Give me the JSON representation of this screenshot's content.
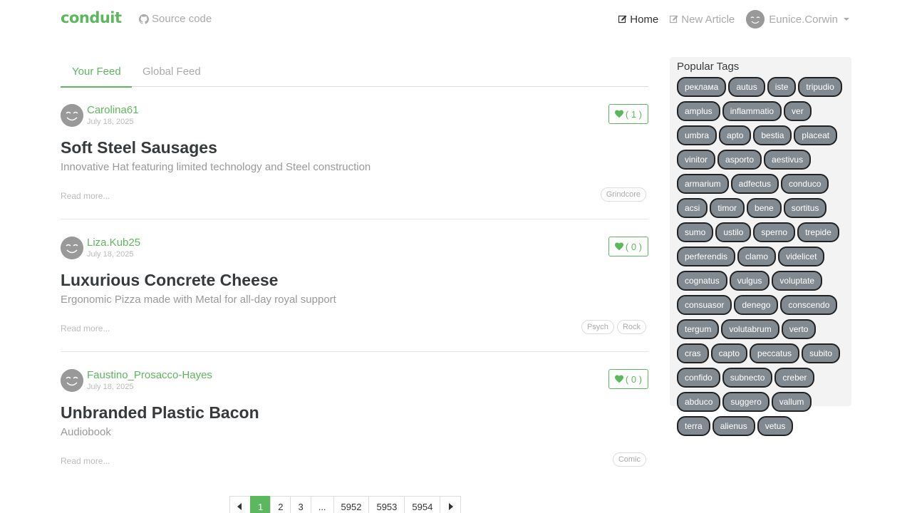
{
  "navbar": {
    "brand": "conduit",
    "source_label": "Source code",
    "home_label": "Home",
    "new_article_label": "New Article",
    "username": "Eunice.Corwin"
  },
  "feed": {
    "tabs": [
      {
        "label": "Your Feed",
        "active": true
      },
      {
        "label": "Global Feed",
        "active": false
      }
    ]
  },
  "articles": [
    {
      "author": "Carolina61",
      "date": "July 18, 2025",
      "likes": "( 1 )",
      "title": "Soft Steel Sausages",
      "description": "Innovative Hat featuring limited technology and Steel construction",
      "read_more": "Read more...",
      "tags": [
        "Grindcore"
      ]
    },
    {
      "author": "Liza.Kub25",
      "date": "July 18, 2025",
      "likes": "( 0 )",
      "title": "Luxurious Concrete Cheese",
      "description": "Ergonomic Pizza made with Metal for all-day royal support",
      "read_more": "Read more...",
      "tags": [
        "Psych",
        "Rock"
      ]
    },
    {
      "author": "Faustino_Prosacco-Hayes",
      "date": "July 18, 2025",
      "likes": "( 0 )",
      "title": "Unbranded Plastic Bacon",
      "description": "Audiobook",
      "read_more": "Read more...",
      "tags": [
        "Comic"
      ]
    }
  ],
  "sidebar": {
    "title": "Popular Tags",
    "tags": [
      "реклама",
      "autus",
      "iste",
      "tripudio",
      "amplus",
      "inflammatio",
      "ver",
      "umbra",
      "apto",
      "bestia",
      "placeat",
      "vinitor",
      "asporto",
      "aestivus",
      "armarium",
      "adfectus",
      "conduco",
      "acsi",
      "timor",
      "bene",
      "sortitus",
      "sumo",
      "ustilo",
      "sperno",
      "trepide",
      "perferendis",
      "clamo",
      "videlicet",
      "cognatus",
      "vulgus",
      "voluptate",
      "consuasor",
      "denego",
      "conscendo",
      "tergum",
      "volutabrum",
      "verto",
      "cras",
      "capto",
      "peccatus",
      "subito",
      "confido",
      "subnecto",
      "creber",
      "abduco",
      "suggero",
      "vallum",
      "terra",
      "alienus",
      "vetus"
    ]
  },
  "pagination": {
    "pages": [
      "1",
      "2",
      "3",
      "...",
      "5952",
      "5953",
      "5954"
    ],
    "active": "1"
  },
  "colors": {
    "brand": "#5cb85c",
    "tag_pill": "#818a91"
  }
}
